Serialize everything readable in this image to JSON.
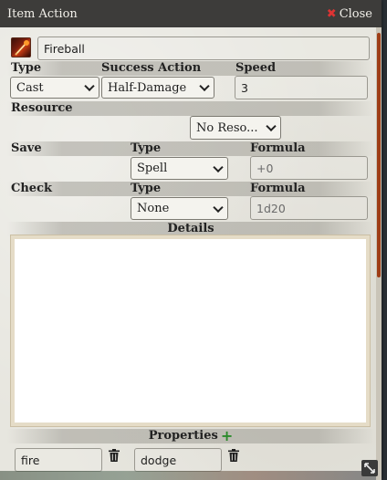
{
  "window": {
    "title": "Item Action",
    "close_label": "Close"
  },
  "item": {
    "icon": "fireball-spell-icon",
    "name": "Fireball"
  },
  "labels": {
    "type": "Type",
    "success_action": "Success Action",
    "speed": "Speed",
    "resource": "Resource",
    "save": "Save",
    "save_type": "Type",
    "save_formula": "Formula",
    "check": "Check",
    "check_type": "Type",
    "check_formula": "Formula",
    "details": "Details",
    "properties": "Properties"
  },
  "fields": {
    "type_value": "Cast",
    "success_action_value": "Half-Damage",
    "speed_value": "3",
    "resource_value": "No Reso...",
    "save_type_value": "Spell",
    "save_formula_value": "+0",
    "check_type_value": "None",
    "check_formula_value": "1d20"
  },
  "details_text": "",
  "properties": [
    {
      "value": "fire"
    },
    {
      "value": "dodge"
    }
  ],
  "colors": {
    "titlebar": "#3d3c3a",
    "close_x": "#dd3333",
    "scroll_thumb": "#9e3d16",
    "add_plus": "#2a8a2a"
  }
}
